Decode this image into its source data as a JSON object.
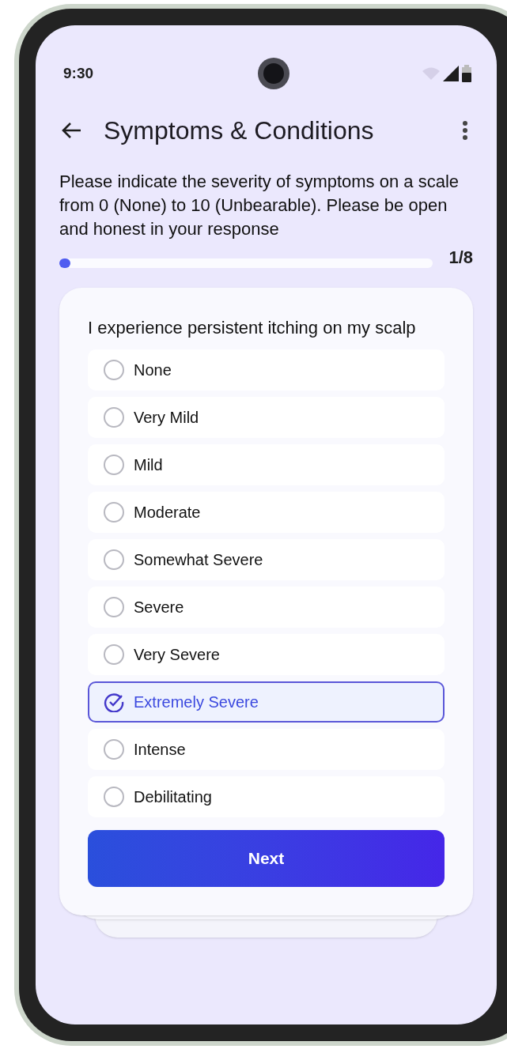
{
  "status_bar": {
    "time": "9:30"
  },
  "app_bar": {
    "title": "Symptoms & Conditions"
  },
  "instructions": "Please indicate the severity of symptoms on a scale from 0 (None) to 10 (Unbearable). Please be open and honest in your response",
  "progress": {
    "level": 0.03,
    "reading": "1/8"
  },
  "question": {
    "text": "I experience persistent itching on my scalp",
    "options": [
      {
        "label": "None",
        "selected": false
      },
      {
        "label": "Very Mild",
        "selected": false
      },
      {
        "label": "Mild",
        "selected": false
      },
      {
        "label": "Moderate",
        "selected": false
      },
      {
        "label": "Somewhat Severe",
        "selected": false
      },
      {
        "label": "Severe",
        "selected": false
      },
      {
        "label": "Very Severe",
        "selected": false
      },
      {
        "label": "Extremely Severe",
        "selected": true
      },
      {
        "label": "Intense",
        "selected": false
      },
      {
        "label": "Debilitating",
        "selected": false
      }
    ]
  },
  "next_button": "Next"
}
